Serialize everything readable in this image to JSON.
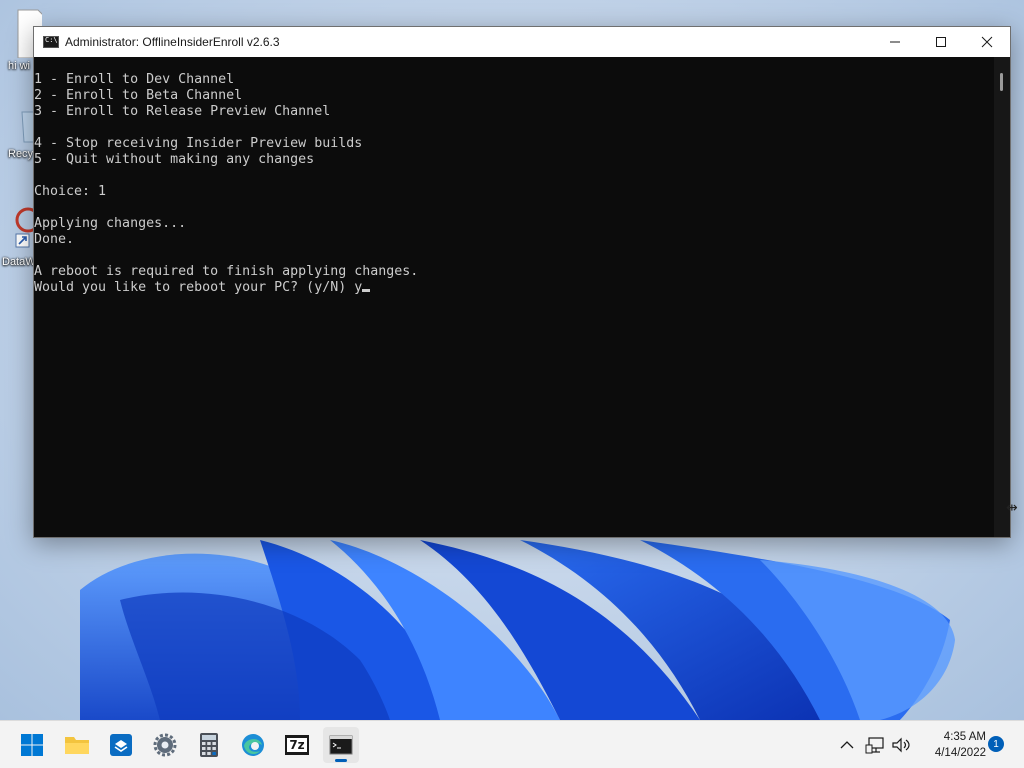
{
  "desktop": {
    "icons": [
      {
        "label": "hi wi"
      },
      {
        "label": "Recy"
      },
      {
        "label": "DataW"
      }
    ]
  },
  "window": {
    "title": "Administrator:  OfflineInsiderEnroll v2.6.3",
    "controls": {
      "minimize": "minimize-icon",
      "maximize": "maximize-icon",
      "close": "close-icon"
    }
  },
  "console": {
    "lines": [
      "1 - Enroll to Dev Channel",
      "2 - Enroll to Beta Channel",
      "3 - Enroll to Release Preview Channel",
      "",
      "4 - Stop receiving Insider Preview builds",
      "5 - Quit without making any changes",
      "",
      "Choice: 1",
      "",
      "Applying changes...",
      "Done.",
      "",
      "A reboot is required to finish applying changes.",
      "Would you like to reboot your PC? (y/N) y"
    ]
  },
  "taskbar": {
    "apps": [
      {
        "name": "start-icon"
      },
      {
        "name": "file-explorer-icon"
      },
      {
        "name": "store-icon"
      },
      {
        "name": "settings-icon"
      },
      {
        "name": "calculator-icon"
      },
      {
        "name": "edge-icon"
      },
      {
        "name": "7zip-icon",
        "text": "7z"
      },
      {
        "name": "terminal-icon",
        "active": true
      }
    ],
    "tray": {
      "time": "4:35 AM",
      "date": "4/14/2022",
      "notification_count": "1"
    }
  },
  "colors": {
    "console_bg": "#0c0c0c",
    "console_fg": "#cccccc",
    "accent": "#005fb8",
    "taskbar": "#f3f3f3"
  }
}
